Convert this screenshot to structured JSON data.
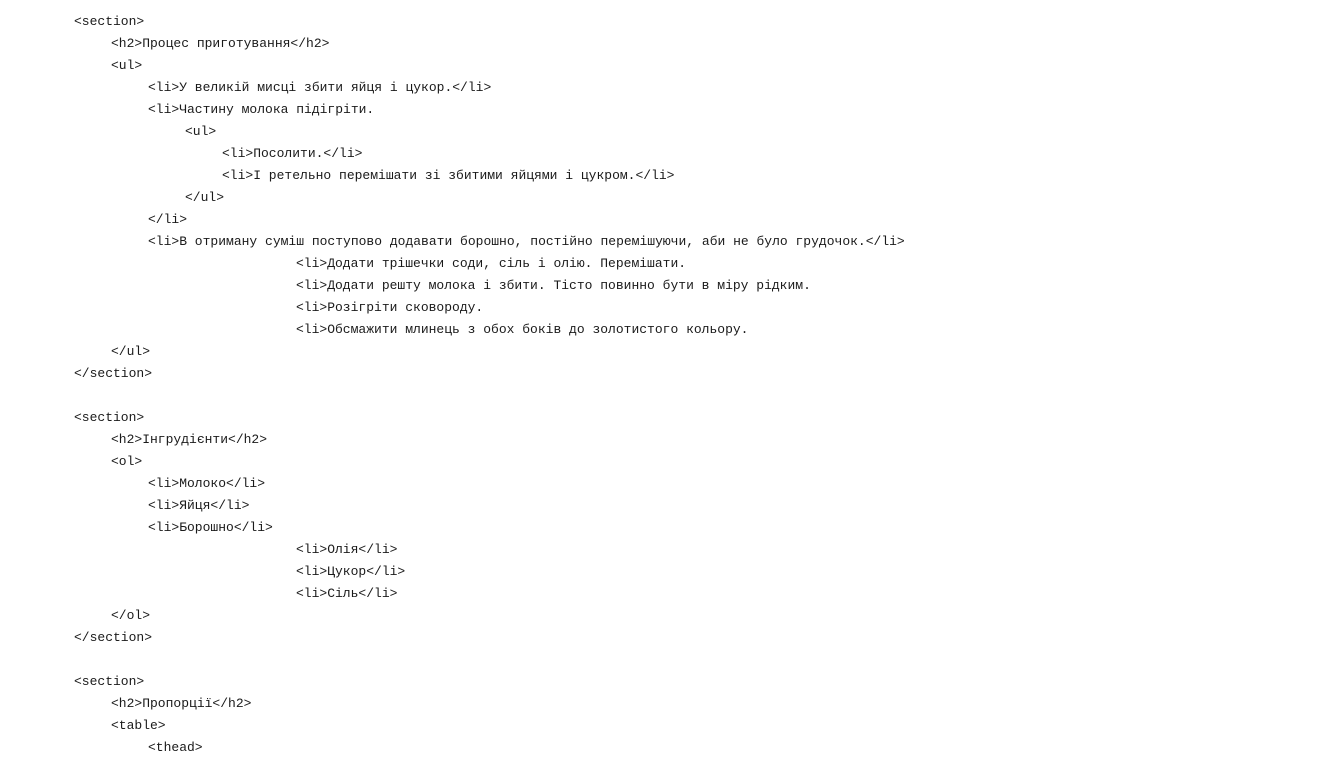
{
  "code_lines": [
    "<section>",
    "<h2>Процес приготування</h2>",
    "<ul>",
    "<li>У великій мисці збити яйця і цукор.</li>",
    "<li>Частину молока підігріти.",
    "<ul>",
    "<li>Посолити.</li>",
    "<li>І ретельно перемішати зі збитими яйцями і цукром.</li>",
    "</ul>",
    "</li>",
    "<li>В отриману суміш поступово додавати борошно, постійно перемішуючи, аби не було грудочок.</li>",
    "<li>Додати трішечки соди, сіль і олію. Перемішати.",
    "<li>Додати решту молока і збити. Тісто повинно бути в міру рідким.",
    "<li>Розігріти сковороду.",
    "<li>Обсмажити млинець з обох боків до золотистого кольору.",
    "</ul>",
    "</section>",
    "",
    "<section>",
    "<h2>Інгрудієнти</h2>",
    "<ol>",
    "<li>Молоко</li>",
    "<li>Яйця</li>",
    "<li>Борошно</li>",
    "<li>Олія</li>",
    "<li>Цукор</li>",
    "<li>Сіль</li>",
    "</ol>",
    "</section>",
    "",
    "<section>",
    "<h2>Пропорції</h2>",
    "<table>",
    "<thead>"
  ]
}
